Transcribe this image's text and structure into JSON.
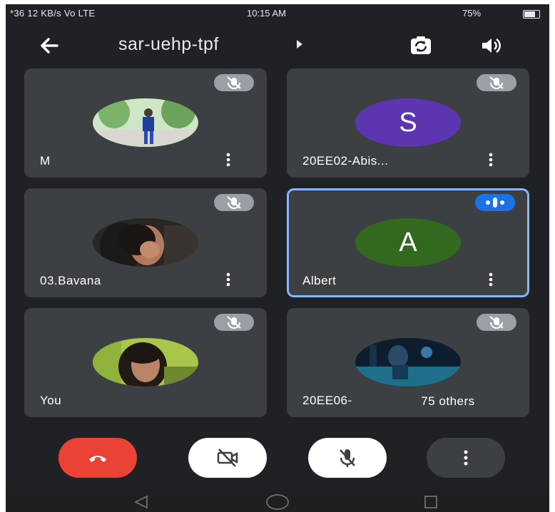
{
  "status_bar": {
    "left_text": "*36 12 KB/s Vo LTE",
    "time": "10:15 AM",
    "battery_text": "75%",
    "battery_level": 0.75
  },
  "header": {
    "title": "sar-uehp-tpf",
    "icons": [
      "back-arrow-icon",
      "switch-camera-icon",
      "speaker-icon"
    ]
  },
  "participants": [
    {
      "name": "M",
      "avatar": "photo",
      "mic": "muted"
    },
    {
      "name": "20EE02-Abis...",
      "avatar": "letter",
      "initial": "S",
      "avatar_color": "#5e35b1",
      "mic": "muted"
    },
    {
      "name": "03.Bavana",
      "avatar": "photo",
      "mic": "muted"
    },
    {
      "name": "Albert",
      "avatar": "letter",
      "initial": "A",
      "avatar_color": "#33691e",
      "mic": "speaking",
      "active": true
    },
    {
      "name": "You",
      "avatar": "photo",
      "mic": "muted"
    },
    {
      "name": "20EE06-",
      "avatar": "photo",
      "mic": "muted"
    }
  ],
  "others_label": "75 others",
  "controls": [
    {
      "name": "end-call",
      "icon": "hang-up-icon",
      "color": "#ea4335"
    },
    {
      "name": "camera",
      "icon": "camera-off-icon",
      "color": "#ffffff"
    },
    {
      "name": "microphone",
      "icon": "mic-off-icon",
      "color": "#ffffff"
    },
    {
      "name": "more",
      "icon": "more-vert-icon",
      "color": "#3c4043"
    }
  ],
  "colors": {
    "background": "#202124",
    "tile": "#3c4043",
    "active_border": "#8ab4f8",
    "speaking": "#1a73e8"
  }
}
